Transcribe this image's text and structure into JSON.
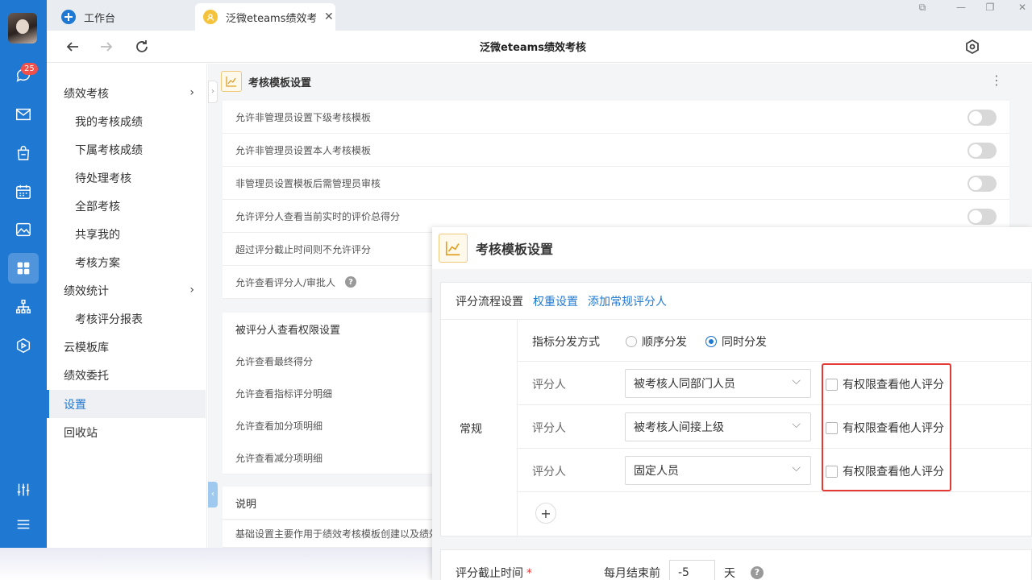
{
  "rail": {
    "badge_count": "25",
    "icons": [
      "avatar",
      "chat-icon",
      "mail-icon",
      "shopping-bag-icon",
      "calendar-icon",
      "image-icon",
      "apps-grid-icon",
      "org-chart-icon",
      "cube-icon",
      "sliders-icon",
      "menu-icon"
    ],
    "accent": "#1f78d1",
    "badge_color": "#f2504b"
  },
  "tabs": [
    {
      "label": "工作台",
      "icon": "workbench-icon"
    },
    {
      "label": "泛微eteams绩效考核",
      "icon": "performance-app-icon"
    }
  ],
  "navbar": {
    "title": "泛微eteams绩效考核",
    "icons": [
      "back-arrow-icon",
      "forward-arrow-icon",
      "refresh-icon",
      "settings-hex-icon",
      "more-icon"
    ]
  },
  "sidenav": {
    "items": [
      {
        "label": "绩效考核",
        "level": 1,
        "expandable": true
      },
      {
        "label": "我的考核成绩",
        "level": 2
      },
      {
        "label": "下属考核成绩",
        "level": 2
      },
      {
        "label": "待处理考核",
        "level": 2
      },
      {
        "label": "全部考核",
        "level": 2
      },
      {
        "label": "共享我的",
        "level": 2
      },
      {
        "label": "考核方案",
        "level": 2
      },
      {
        "label": "绩效统计",
        "level": 1,
        "expandable": true
      },
      {
        "label": "考核评分报表",
        "level": 2
      },
      {
        "label": "云模板库",
        "level": 1
      },
      {
        "label": "绩效委托",
        "level": 1
      },
      {
        "label": "设置",
        "level": 1,
        "active": true
      },
      {
        "label": "回收站",
        "level": 1
      }
    ]
  },
  "background_card": {
    "title": "考核模板设置",
    "toggles": [
      "允许非管理员设置下级考核模板",
      "允许非管理员设置本人考核模板",
      "非管理员设置模板后需管理员审核",
      "允许评分人查看当前实时的评价总得分",
      "超过评分截止时间则不允许评分",
      "允许查看评分人/审批人"
    ],
    "help_mark": "?",
    "perm_section_title": "被评分人查看权限设置",
    "perm_items": [
      "允许查看最终得分",
      "允许查看指标评分明细",
      "允许查看加分项明细",
      "允许查看减分项明细"
    ],
    "note_title": "说明",
    "note_text": "基础设置主要作用于绩效考核模板创建以及绩效"
  },
  "overlay": {
    "title": "考核模板设置",
    "tabs": [
      "评分流程设置",
      "权重设置",
      "添加常规评分人"
    ],
    "row_label": "常规",
    "distribution_label": "指标分发方式",
    "distribution_options": [
      {
        "label": "顺序分发",
        "selected": false
      },
      {
        "label": "同时分发",
        "selected": true
      }
    ],
    "raters": [
      {
        "label": "评分人",
        "value": "被考核人同部门人员",
        "permission_label": "有权限查看他人评分",
        "checked": false
      },
      {
        "label": "评分人",
        "value": "被考核人间接上级",
        "permission_label": "有权限查看他人评分",
        "checked": false
      },
      {
        "label": "评分人",
        "value": "固定人员",
        "permission_label": "有权限查看他人评分",
        "checked": false
      }
    ],
    "add_symbol": "+",
    "deadline": {
      "label": "评分截止时间",
      "required_mark": "*",
      "prefix": "每月结束前",
      "value": "-5",
      "unit": "天",
      "help_mark": "?"
    },
    "highlight_color": "#e53935"
  }
}
